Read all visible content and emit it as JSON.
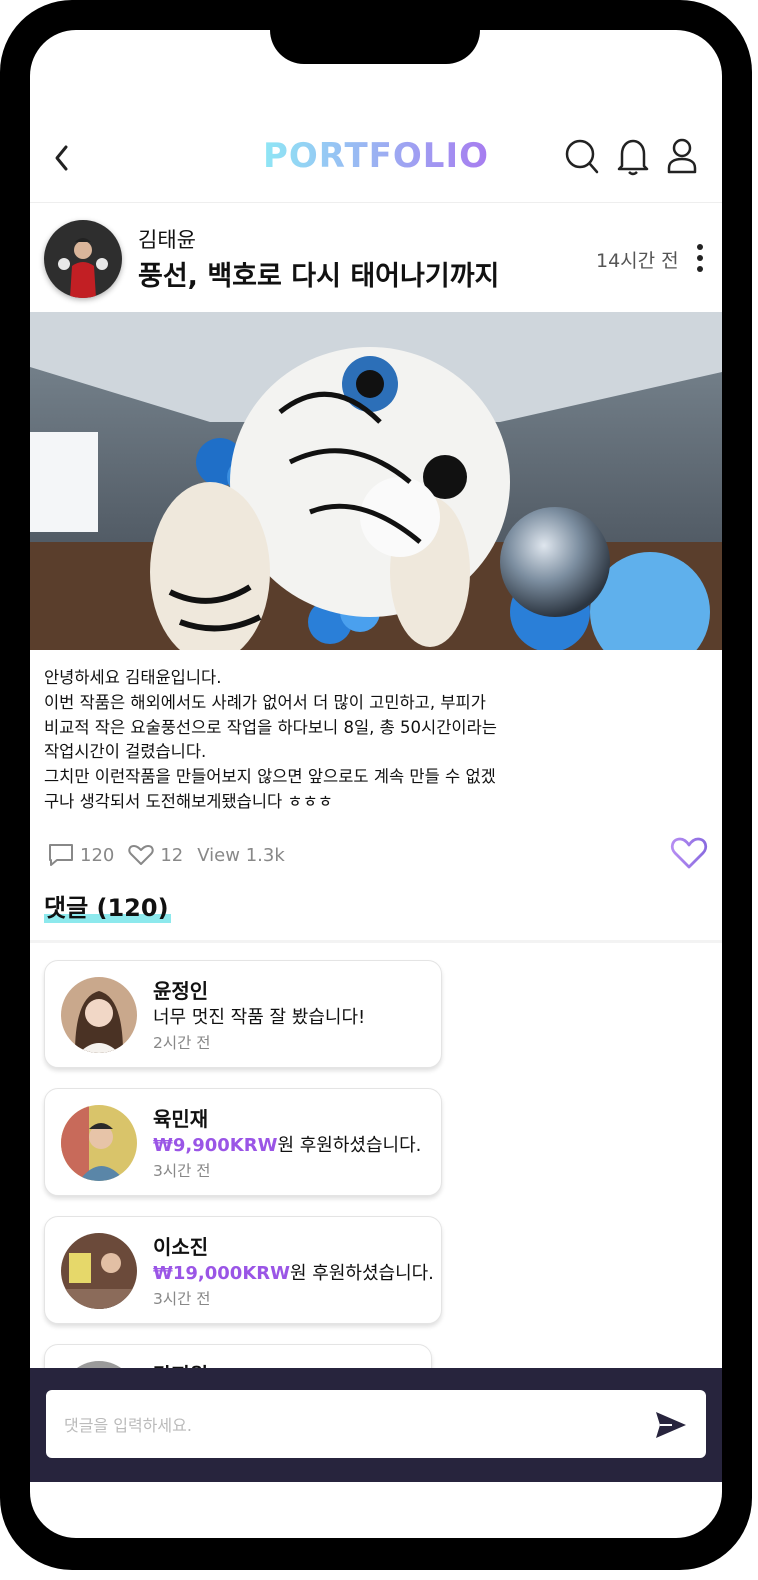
{
  "header": {
    "logo": "PORTFOLIO"
  },
  "post": {
    "author": "김태윤",
    "title": "풍선, 백호로 다시 태어나기까지",
    "time": "14시간 전",
    "body": "안녕하세요 김태윤입니다.\n이번 작품은 해외에서도 사례가 없어서 더 많이 고민하고, 부피가\n비교적 작은 요술풍선으로 작업을 하다보니 8일, 총 50시간이라는\n작업시간이 걸렸습니다.\n그치만 이런작품을 만들어보지 않으면 앞으로도 계속 만들 수 없겠\n구나 생각되서 도전해보게됐습니다 ㅎㅎㅎ",
    "comment_count": "120",
    "like_count": "12",
    "views": "View 1.3k"
  },
  "comments_section": {
    "title": "댓글 (120)"
  },
  "comments": [
    {
      "name": "윤정인",
      "message": "너무 멋진 작품 잘 봤습니다!",
      "time": "2시간 전"
    },
    {
      "name": "육민재",
      "amount": "₩9,900KRW",
      "message": "원 후원하셨습니다.",
      "time": "3시간 전"
    },
    {
      "name": "이소진",
      "amount": "₩19,000KRW",
      "message": "원 후원하셨습니다.",
      "time": "3시간 전"
    },
    {
      "name": "강지원"
    }
  ],
  "comment_input": {
    "placeholder": "댓글을 입력하세요."
  },
  "colors": {
    "accent": "#a77cf0",
    "highlight": "#8de9ed",
    "amount": "#9a55e6",
    "bottom_bar": "#27243d"
  },
  "icons": [
    "back-icon",
    "search-icon",
    "bell-icon",
    "user-icon",
    "more-icon",
    "comment-icon",
    "heart-icon",
    "send-icon"
  ]
}
